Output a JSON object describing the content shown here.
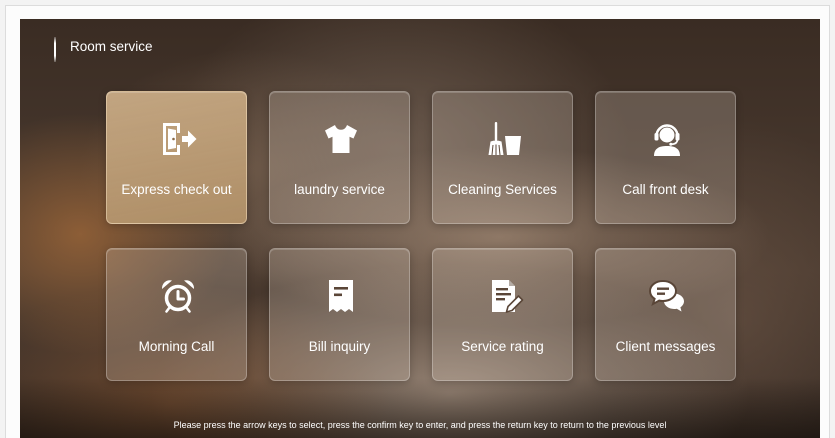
{
  "header": {
    "title": "Room service"
  },
  "services": [
    {
      "label": "Express check out",
      "icon": "exit-door-icon",
      "selected": true
    },
    {
      "label": "laundry service",
      "icon": "tshirt-icon",
      "selected": false
    },
    {
      "label": "Cleaning Services",
      "icon": "broom-bucket-icon",
      "selected": false
    },
    {
      "label": "Call front desk",
      "icon": "headset-agent-icon",
      "selected": false
    },
    {
      "label": "Morning Call",
      "icon": "alarm-clock-icon",
      "selected": false
    },
    {
      "label": "Bill inquiry",
      "icon": "receipt-icon",
      "selected": false
    },
    {
      "label": "Service rating",
      "icon": "document-edit-icon",
      "selected": false
    },
    {
      "label": "Client messages",
      "icon": "chat-bubbles-icon",
      "selected": false
    }
  ],
  "footer": {
    "hint": "Please press the arrow keys to select, press the confirm key to enter, and press the return key to return to the previous level"
  },
  "colors": {
    "selected_tile": "#b8966c",
    "text": "#ffffff"
  }
}
